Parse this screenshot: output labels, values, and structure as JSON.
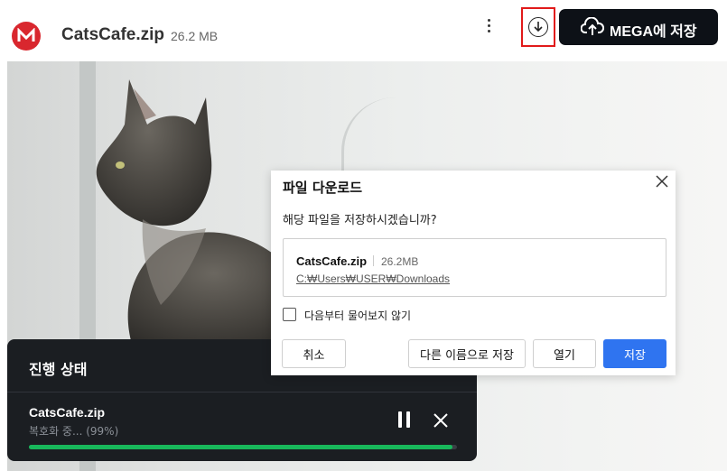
{
  "header": {
    "file_name": "CatsCafe.zip",
    "file_size": "26.2 MB",
    "save_to_mega_label": "MEGA에 저장"
  },
  "progress_panel": {
    "title": "진행 상태",
    "file_name": "CatsCafe.zip",
    "status": "복호화 중... (99%)",
    "progress_percent": 99
  },
  "download_dialog": {
    "title": "파일 다운로드",
    "question": "해당 파일을 저장하시겠습니까?",
    "file_name": "CatsCafe.zip",
    "file_size": "26.2MB",
    "path": "C:₩Users₩USER₩Downloads",
    "checkbox_label": "다음부터 물어보지 않기",
    "checkbox_checked": false,
    "buttons": {
      "cancel": "취소",
      "save_as": "다른 이름으로 저장",
      "open": "열기",
      "save": "저장"
    }
  },
  "colors": {
    "mega_red": "#d9272e",
    "highlight": "#e11a1a",
    "progress_green": "#18b85b",
    "save_blue": "#2f74f0"
  },
  "icons": {
    "logo": "mega-logo",
    "menu": "kebab-menu-icon",
    "download": "download-circle-icon",
    "upload": "cloud-upload-icon",
    "pause": "pause-icon",
    "close": "close-icon"
  }
}
